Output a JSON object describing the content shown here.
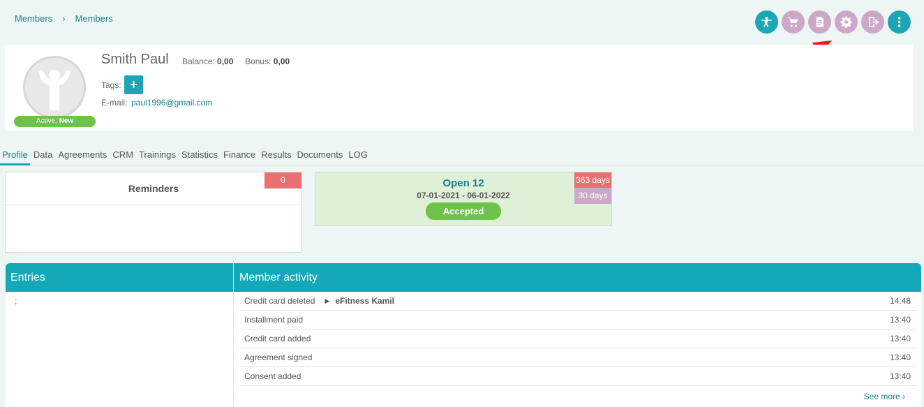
{
  "breadcrumb": {
    "items": [
      "Members",
      "Members"
    ]
  },
  "actions": [
    {
      "icon": "fitness-icon",
      "color": "#1ba6b3"
    },
    {
      "icon": "cart-icon",
      "color": "#cda7c7"
    },
    {
      "icon": "document-icon",
      "color": "#cda7c7"
    },
    {
      "icon": "gear-icon",
      "color": "#cda7c7"
    },
    {
      "icon": "exit-icon",
      "color": "#cda7c7"
    },
    {
      "icon": "more-vertical-icon",
      "color": "#1ba6b3"
    }
  ],
  "member": {
    "name": "Smith Paul",
    "balance_label": "Balance:",
    "balance_value": "0,00",
    "bonus_label": "Bonus:",
    "bonus_value": "0,00",
    "tags_label": "Tags:",
    "add_tag_label": "+",
    "email_label": "E-mail:",
    "email": "paul1996@gmail.com",
    "status_label": "Active:",
    "status_value": "New"
  },
  "tabs": [
    "Profile",
    "Data",
    "Agreements",
    "CRM",
    "Trainings",
    "Statistics",
    "Finance",
    "Results",
    "Documents",
    "LOG"
  ],
  "active_tab": "Profile",
  "reminders": {
    "title": "Reminders",
    "count": "0"
  },
  "agreement": {
    "name": "Open 12",
    "dates": "07-01-2021 - 06-01-2022",
    "status": "Accepted",
    "days_total": "363 days",
    "days_period": "30 days"
  },
  "entries": {
    "title": "Entries",
    "content": ";"
  },
  "activity": {
    "title": "Member activity",
    "rows": [
      {
        "text": "Credit card deleted",
        "actor": "eFitness Kamil",
        "time": "14:48"
      },
      {
        "text": "Installment paid",
        "actor": "",
        "time": "13:40"
      },
      {
        "text": "Credit card added",
        "actor": "",
        "time": "13:40"
      },
      {
        "text": "Agreement signed",
        "actor": "",
        "time": "13:40"
      },
      {
        "text": "Consent added",
        "actor": "",
        "time": "13:40"
      }
    ],
    "see_more": "See more ›"
  },
  "colors": {
    "accent": "#1ba6b3",
    "mauve": "#cda7c7",
    "green": "#6cc24a",
    "red": "#e97070",
    "annotation_arrow": "#ee1c1c"
  }
}
